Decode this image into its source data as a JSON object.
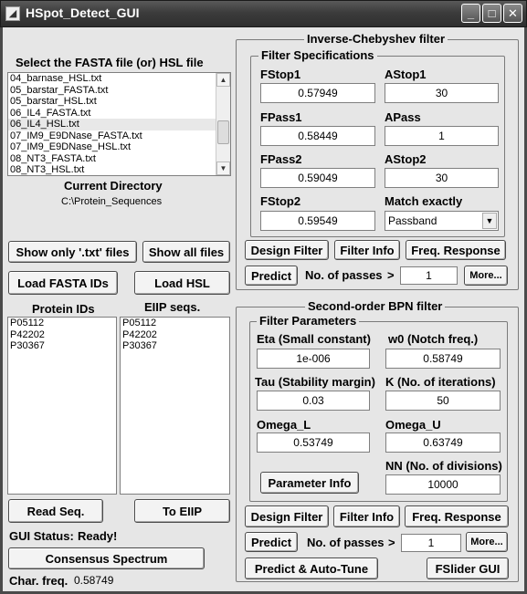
{
  "window": {
    "title": "HSpot_Detect_GUI",
    "minimize": "_",
    "maximize": "□",
    "close": "✕"
  },
  "left": {
    "fasta_label": "Select the FASTA file (or) HSL file",
    "files": [
      "04_barnase_HSL.txt",
      "05_barstar_FASTA.txt",
      "05_barstar_HSL.txt",
      "06_IL4_FASTA.txt",
      "06_IL4_HSL.txt",
      "07_IM9_E9DNase_FASTA.txt",
      "07_IM9_E9DNase_HSL.txt",
      "08_NT3_FASTA.txt",
      "08_NT3_HSL.txt"
    ],
    "current_dir_label": "Current Directory",
    "current_dir": "C:\\Protein_Sequences",
    "show_txt": "Show only '.txt' files",
    "show_all": "Show all files",
    "load_fasta": "Load FASTA IDs",
    "load_hsl": "Load HSL",
    "protein_ids_label": "Protein IDs",
    "eiip_label": "EIIP seqs.",
    "protein_ids": [
      "P05112",
      "P42202",
      "P30367"
    ],
    "eiip_seqs": [
      "P05112",
      "P42202",
      "P30367"
    ],
    "read_seq": "Read Seq.",
    "to_eiip": "To EIIP",
    "status_label": "GUI Status:",
    "status_value": "Ready!",
    "consensus": "Consensus Spectrum",
    "char_freq_label": "Char. freq.",
    "char_freq_value": "0.58749"
  },
  "cheby": {
    "title": "Inverse-Chebyshev filter",
    "spec_title": "Filter Specifications",
    "fstop1_label": "FStop1",
    "fstop1": "0.57949",
    "astop1_label": "AStop1",
    "astop1": "30",
    "fpass1_label": "FPass1",
    "fpass1": "0.58449",
    "apass_label": "APass",
    "apass": "1",
    "fpass2_label": "FPass2",
    "fpass2": "0.59049",
    "astop2_label": "AStop2",
    "astop2": "30",
    "fstop2_label": "FStop2",
    "fstop2": "0.59549",
    "match_label": "Match exactly",
    "match_value": "Passband",
    "design": "Design Filter",
    "info": "Filter Info",
    "freq": "Freq. Response",
    "predict": "Predict",
    "passes_label": "No. of passes",
    "gt": ">",
    "passes": "1",
    "more": "More..."
  },
  "bpn": {
    "title": "Second-order BPN filter",
    "param_title": "Filter Parameters",
    "eta_label": "Eta (Small constant)",
    "eta": "1e-006",
    "w0_label": "w0 (Notch freq.)",
    "w0": "0.58749",
    "tau_label": "Tau (Stability margin)",
    "tau": "0.03",
    "k_label": "K (No. of iterations)",
    "k": "50",
    "omega_l_label": "Omega_L",
    "omega_l": "0.53749",
    "omega_u_label": "Omega_U",
    "omega_u": "0.63749",
    "nn_label": "NN (No. of divisions)",
    "nn": "10000",
    "param_info": "Parameter Info",
    "design": "Design Filter",
    "info": "Filter Info",
    "freq": "Freq. Response",
    "predict": "Predict",
    "passes_label": "No. of passes",
    "gt": ">",
    "passes": "1",
    "more": "More...",
    "auto_tune": "Predict & Auto-Tune",
    "fslider": "FSlider GUI"
  }
}
